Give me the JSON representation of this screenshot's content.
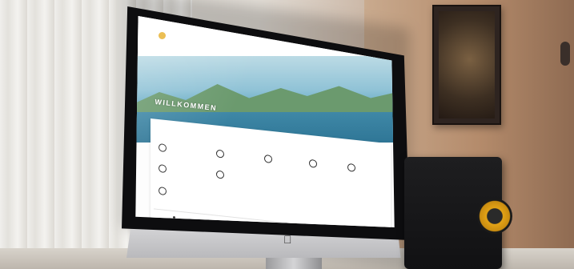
{
  "scene": {
    "description_tags": [
      "desk",
      "curtain",
      "wall",
      "framed-picture",
      "speaker",
      "imac"
    ]
  },
  "website": {
    "logo_text": "",
    "hero_title": "WILLKOMMEN",
    "booking_title": "",
    "booking_subtitle": "",
    "nav_items": [],
    "options": [
      {
        "label": ""
      },
      {
        "label": ""
      },
      {
        "label": ""
      },
      {
        "label": ""
      },
      {
        "label": ""
      },
      {
        "label": ""
      },
      {
        "label": ""
      },
      {
        "label": ""
      }
    ]
  },
  "colors": {
    "accent": "#17305a",
    "logo_gold": "#e8b53a",
    "speaker_woofer": "#e2a216"
  }
}
